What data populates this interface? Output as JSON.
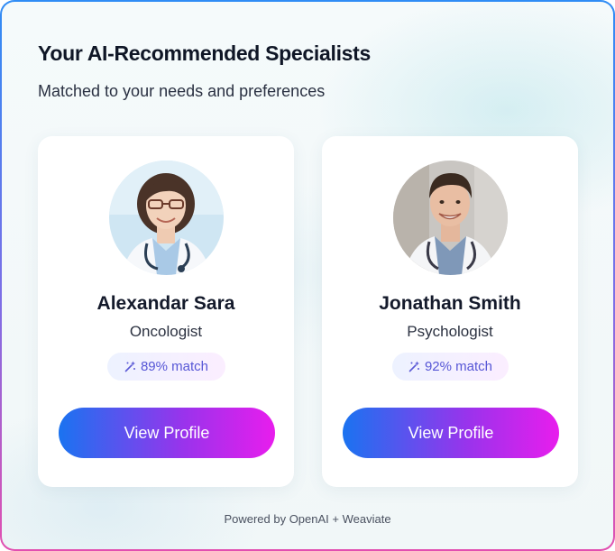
{
  "header": {
    "title": "Your AI-Recommended Specialists",
    "subtitle": "Matched to your needs and preferences"
  },
  "specialists": [
    {
      "name": "Alexandar Sara",
      "specialty": "Oncologist",
      "match": "89% match",
      "button_label": "View Profile",
      "avatar_icon": "doctor-photo"
    },
    {
      "name": "Jonathan Smith",
      "specialty": "Psychologist",
      "match": "92% match",
      "button_label": "View Profile",
      "avatar_icon": "doctor-photo"
    }
  ],
  "footer": {
    "powered_by": "Powered by OpenAI + Weaviate"
  },
  "colors": {
    "button_gradient_start": "#1a73f0",
    "button_gradient_end": "#e81ded",
    "badge_text": "#5656d6",
    "border_top": "#2f8cf5",
    "border_bottom": "#e24fb0"
  }
}
